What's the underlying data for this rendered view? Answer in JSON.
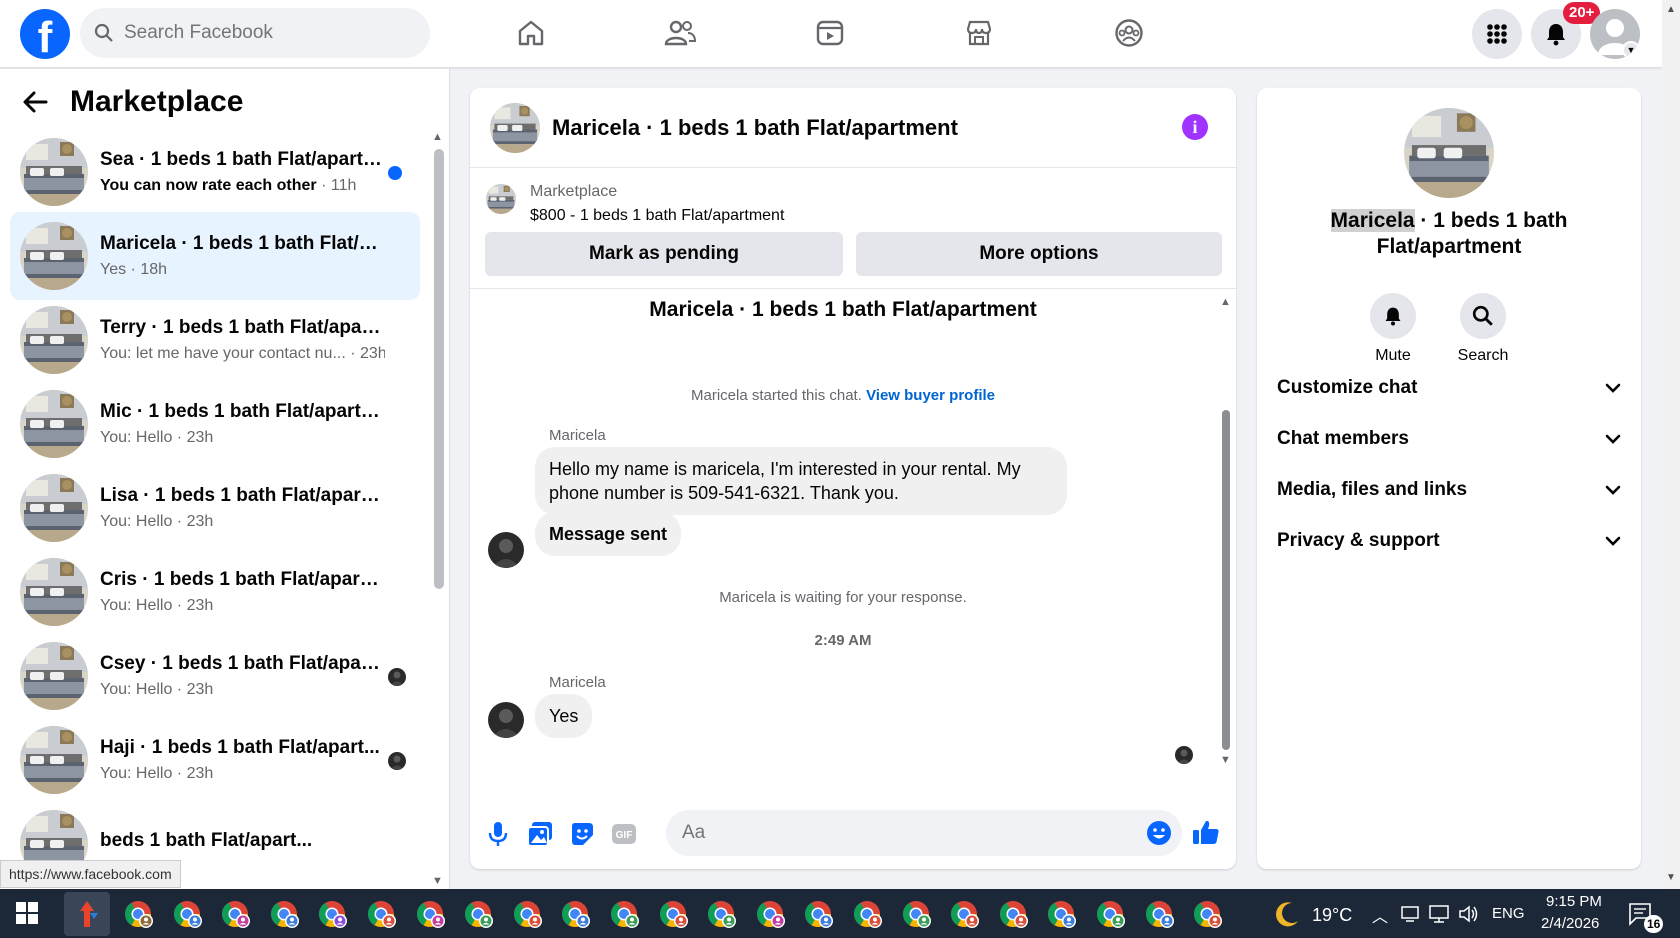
{
  "topbar": {
    "search_placeholder": "Search Facebook",
    "notification_badge": "20+",
    "icons": [
      "home-icon",
      "friends-icon",
      "watch-icon",
      "marketplace-icon",
      "groups-icon",
      "menu-grid-icon",
      "bell-icon",
      "profile-avatar"
    ]
  },
  "sidebar": {
    "title": "Marketplace",
    "conversations": [
      {
        "name": "Sea · 1 beds 1 bath Flat/apartm...",
        "preview": "You can now rate each other",
        "time": " · 11h",
        "unread": true
      },
      {
        "name": "Maricela · 1 beds 1 bath Flat/apa...",
        "preview": "Yes",
        "time": " · 18h",
        "active": true
      },
      {
        "name": "Terry · 1 beds 1 bath Flat/apartm...",
        "preview": "You: let me have your contact nu...",
        "time": " · 23h"
      },
      {
        "name": "Mic · 1 beds 1 bath Flat/apartment",
        "preview": "You: Hello",
        "time": " · 23h"
      },
      {
        "name": "Lisa · 1 beds 1 bath Flat/apartment",
        "preview": "You: Hello",
        "time": " · 23h"
      },
      {
        "name": "Cris · 1 beds 1 bath Flat/apartment",
        "preview": "You: Hello",
        "time": " · 23h"
      },
      {
        "name": "Csey · 1 beds 1 bath Flat/apart...",
        "preview": "You: Hello",
        "time": " · 23h"
      },
      {
        "name": "Haji · 1 beds 1 bath Flat/apart...",
        "preview": "You: Hello",
        "time": " · 23h"
      },
      {
        "name": "beds 1 bath Flat/apart...",
        "preview": "",
        "time": ""
      }
    ],
    "status_url": "https://www.facebook.com"
  },
  "chat": {
    "title": "Maricela · 1 beds 1 bath Flat/apartment",
    "listing_source": "Marketplace",
    "listing_price": "$800 - 1 beds 1 bath Flat/apartment",
    "mark_pending": "Mark as pending",
    "more_options": "More options",
    "thread_title": "Maricela · 1 beds 1 bath Flat/apartment",
    "started_text": "Maricela started this chat.",
    "view_profile": "View buyer profile",
    "sender1": "Maricela",
    "message1": "Hello my name is maricela, I'm interested in your rental. My phone number is 509-541-6321. Thank you.",
    "message2": "Message sent",
    "waiting_text": "Maricela is waiting for your response.",
    "timestamp": "2:49 AM",
    "sender2": "Maricela",
    "message3": "Yes",
    "composer_placeholder": "Aa"
  },
  "right_panel": {
    "name_highlight": "Maricela",
    "name_rest": " · 1 beds 1 bath Flat/apartment",
    "mute": "Mute",
    "search": "Search",
    "sections": [
      "Customize chat",
      "Chat members",
      "Media, files and links",
      "Privacy & support"
    ]
  },
  "taskbar": {
    "weather": "19°C",
    "language": "ENG",
    "time": "9:15 PM",
    "date": "2/4/2026",
    "notification_count": "16"
  },
  "colors": {
    "brand": "#0866ff",
    "active_row": "#e7f3ff",
    "info_purple": "#a033ff",
    "badge_red": "#e41e3f"
  }
}
